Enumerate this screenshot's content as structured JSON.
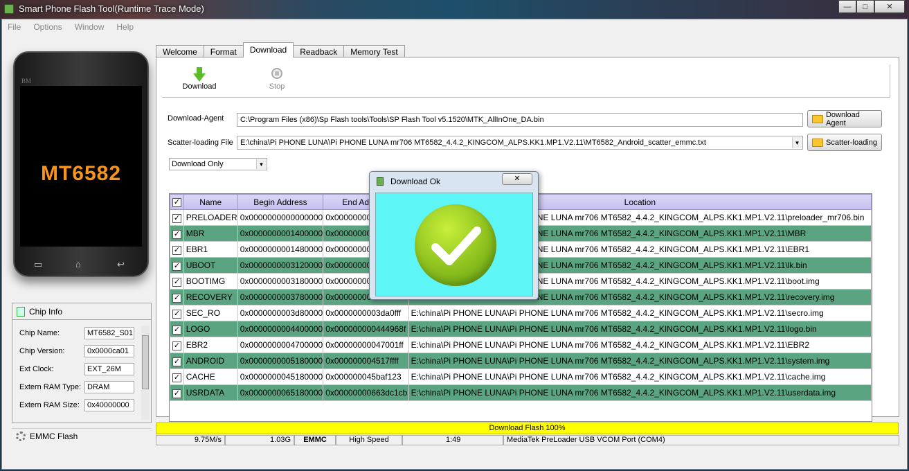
{
  "window": {
    "title": "Smart Phone Flash Tool(Runtime Trace Mode)",
    "minimize": "—",
    "maximize": "□",
    "close": "✕"
  },
  "menu": [
    "File",
    "Options",
    "Window",
    "Help"
  ],
  "phone": {
    "brand": "BM",
    "chip_label": "MT6582"
  },
  "chip_info": {
    "title": "Chip Info",
    "fields": [
      {
        "label": "Chip Name:",
        "value": "MT6582_S01"
      },
      {
        "label": "Chip Version:",
        "value": "0x0000ca01"
      },
      {
        "label": "Ext Clock:",
        "value": "EXT_26M"
      },
      {
        "label": "Extern RAM Type:",
        "value": "DRAM"
      },
      {
        "label": "Extern RAM Size:",
        "value": "0x40000000"
      }
    ]
  },
  "storage_label": "EMMC Flash",
  "tabs": [
    "Welcome",
    "Format",
    "Download",
    "Readback",
    "Memory Test"
  ],
  "active_tab": "Download",
  "toolbar": {
    "download": "Download",
    "stop": "Stop"
  },
  "download_agent": {
    "label": "Download-Agent",
    "value": "C:\\Program Files (x86)\\Sp Flash tools\\Tools\\SP Flash Tool v5.1520\\MTK_AllInOne_DA.bin",
    "button": "Download Agent"
  },
  "scatter": {
    "label": "Scatter-loading File",
    "value": "E:\\china\\Pi PHONE LUNA\\Pi PHONE LUNA mr706 MT6582_4.4.2_KINGCOM_ALPS.KK1.MP1.V2.11\\MT6582_Android_scatter_emmc.txt",
    "button": "Scatter-loading"
  },
  "mode_select": "Download Only",
  "table": {
    "headers": [
      "Name",
      "Begin Address",
      "End Address",
      "Location"
    ],
    "rows": [
      {
        "name": "PRELOADER",
        "begin": "0x0000000000000000",
        "end": "0x000000000001d5ab",
        "location": "E:\\china\\Pi PHONE LUNA\\Pi PHONE LUNA mr706 MT6582_4.4.2_KINGCOM_ALPS.KK1.MP1.V2.11\\preloader_mr706.bin"
      },
      {
        "name": "MBR",
        "begin": "0x0000000001400000",
        "end": "0x00000000014001ff",
        "location": "E:\\china\\Pi PHONE LUNA\\Pi PHONE LUNA mr706 MT6582_4.4.2_KINGCOM_ALPS.KK1.MP1.V2.11\\MBR"
      },
      {
        "name": "EBR1",
        "begin": "0x0000000001480000",
        "end": "0x00000000014801ff",
        "location": "E:\\china\\Pi PHONE LUNA\\Pi PHONE LUNA mr706 MT6582_4.4.2_KINGCOM_ALPS.KK1.MP1.V2.11\\EBR1"
      },
      {
        "name": "UBOOT",
        "begin": "0x0000000003120000",
        "end": "0x000000000315d5ff",
        "location": "E:\\china\\Pi PHONE LUNA\\Pi PHONE LUNA mr706 MT6582_4.4.2_KINGCOM_ALPS.KK1.MP1.V2.11\\lk.bin"
      },
      {
        "name": "BOOTIMG",
        "begin": "0x0000000003180000",
        "end": "0x00000000035e07ff",
        "location": "E:\\china\\Pi PHONE LUNA\\Pi PHONE LUNA mr706 MT6582_4.4.2_KINGCOM_ALPS.KK1.MP1.V2.11\\boot.img"
      },
      {
        "name": "RECOVERY",
        "begin": "0x0000000003780000",
        "end": "0x0000000003be07ff",
        "location": "E:\\china\\Pi PHONE LUNA\\Pi PHONE LUNA mr706 MT6582_4.4.2_KINGCOM_ALPS.KK1.MP1.V2.11\\recovery.img"
      },
      {
        "name": "SEC_RO",
        "begin": "0x0000000003d80000",
        "end": "0x0000000003da0fff",
        "location": "E:\\china\\Pi PHONE LUNA\\Pi PHONE LUNA mr706 MT6582_4.4.2_KINGCOM_ALPS.KK1.MP1.V2.11\\secro.img"
      },
      {
        "name": "LOGO",
        "begin": "0x0000000004400000",
        "end": "0x000000000444968f",
        "location": "E:\\china\\Pi PHONE LUNA\\Pi PHONE LUNA mr706 MT6582_4.4.2_KINGCOM_ALPS.KK1.MP1.V2.11\\logo.bin"
      },
      {
        "name": "EBR2",
        "begin": "0x0000000004700000",
        "end": "0x00000000047001ff",
        "location": "E:\\china\\Pi PHONE LUNA\\Pi PHONE LUNA mr706 MT6582_4.4.2_KINGCOM_ALPS.KK1.MP1.V2.11\\EBR2"
      },
      {
        "name": "ANDROID",
        "begin": "0x0000000005180000",
        "end": "0x000000004517ffff",
        "location": "E:\\china\\Pi PHONE LUNA\\Pi PHONE LUNA mr706 MT6582_4.4.2_KINGCOM_ALPS.KK1.MP1.V2.11\\system.img"
      },
      {
        "name": "CACHE",
        "begin": "0x0000000045180000",
        "end": "0x000000045baf123",
        "location": "E:\\china\\Pi PHONE LUNA\\Pi PHONE LUNA mr706 MT6582_4.4.2_KINGCOM_ALPS.KK1.MP1.V2.11\\cache.img"
      },
      {
        "name": "USRDATA",
        "begin": "0x0000000065180000",
        "end": "0x00000000663dc1cb",
        "location": "E:\\china\\Pi PHONE LUNA\\Pi PHONE LUNA mr706 MT6582_4.4.2_KINGCOM_ALPS.KK1.MP1.V2.11\\userdata.img"
      }
    ]
  },
  "progress": {
    "label": "Download Flash 100%",
    "fraction": 1.0,
    "color": "#ffff00"
  },
  "status": {
    "speed": "9.75M/s",
    "size": "1.03G",
    "storage": "EMMC",
    "usb_speed": "High Speed",
    "time": "1:49",
    "port": "MediaTek PreLoader USB VCOM Port (COM4)"
  },
  "dialog": {
    "title": "Download Ok",
    "close": "✕"
  },
  "colors": {
    "row_highlight": "#5aa481",
    "dialog_body": "#5ef5f7",
    "chip_label": "#f7941d"
  }
}
